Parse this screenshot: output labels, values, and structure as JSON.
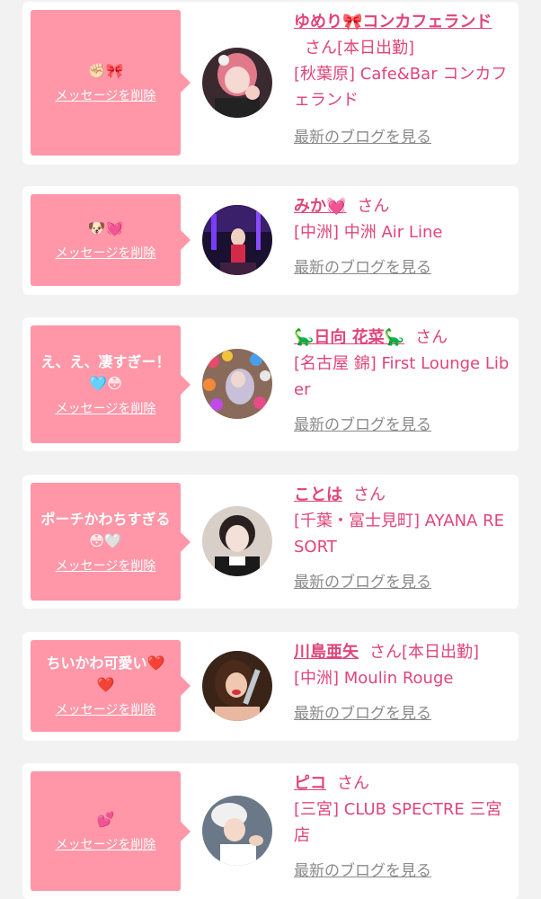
{
  "common": {
    "san": "さん",
    "delete_label": "メッセージを削除",
    "blog_label": "最新のブログを見る"
  },
  "cards": [
    {
      "message": "✊🏻🎀",
      "name": "ゆめり🎀コンカフェランド",
      "badge": "[本日出勤]",
      "shop": "[秋葉原] Cafe&Bar コンカフェランド"
    },
    {
      "message": "🐶💓",
      "name": "みか💓",
      "badge": "",
      "shop": "[中洲] 中洲 Air Line"
    },
    {
      "message": "え、え、凄すぎー！🩵😳",
      "name": "🦕日向 花菜🦕",
      "badge": "",
      "shop": "[名古屋 錦] First Lounge Liber"
    },
    {
      "message": "ポーチかわちすぎる😳🤍",
      "name": "ことは",
      "badge": "",
      "shop": "[千葉・富士見町] AYANA RESORT"
    },
    {
      "message": "ちいかわ可愛い❤️❤️",
      "name": "川島亜矢",
      "badge": "[本日出勤]",
      "shop": "[中洲] Moulin Rouge"
    },
    {
      "message": "💕",
      "name": "ピコ",
      "badge": "",
      "shop": "[三宮] CLUB SPECTRE 三宮店"
    }
  ]
}
